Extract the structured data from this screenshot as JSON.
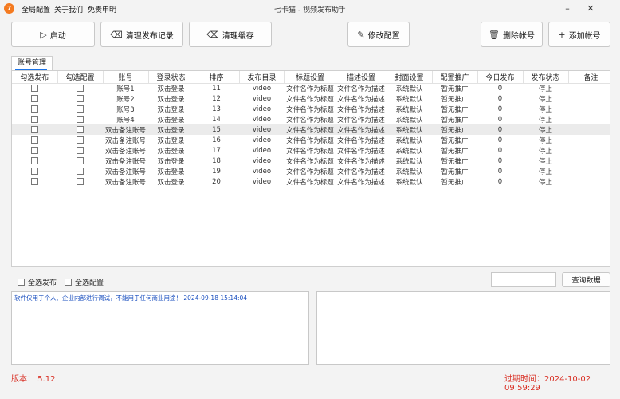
{
  "window": {
    "title": "七卡猫 - 视频发布助手",
    "app_icon": "7",
    "minimize": "–",
    "close": "✕"
  },
  "menu": [
    "全局配置",
    "关于我们",
    "免责申明"
  ],
  "toolbar": {
    "start": "启动",
    "clear_log": "清理发布记录",
    "clear_cache": "清理缓存",
    "modify_config": "修改配置",
    "delete_account": "删除帐号",
    "add_account": "添加帐号"
  },
  "tab": {
    "label": "账号管理"
  },
  "table": {
    "columns": [
      "勾选发布",
      "勾选配置",
      "账号",
      "登录状态",
      "排序",
      "发布目录",
      "标题设置",
      "描述设置",
      "封面设置",
      "配置推广",
      "今日发布",
      "发布状态",
      "备注"
    ],
    "rows": [
      [
        "账号1",
        "双击登录",
        "11",
        "video",
        "文件名作为标题",
        "文件名作为描述",
        "系统默认",
        "暂无推广",
        "0",
        "停止",
        ""
      ],
      [
        "账号2",
        "双击登录",
        "12",
        "video",
        "文件名作为标题",
        "文件名作为描述",
        "系统默认",
        "暂无推广",
        "0",
        "停止",
        ""
      ],
      [
        "账号3",
        "双击登录",
        "13",
        "video",
        "文件名作为标题",
        "文件名作为描述",
        "系统默认",
        "暂无推广",
        "0",
        "停止",
        ""
      ],
      [
        "账号4",
        "双击登录",
        "14",
        "video",
        "文件名作为标题",
        "文件名作为描述",
        "系统默认",
        "暂无推广",
        "0",
        "停止",
        ""
      ],
      [
        "双击备注账号",
        "双击登录",
        "15",
        "video",
        "文件名作为标题",
        "文件名作为描述",
        "系统默认",
        "暂无推广",
        "0",
        "停止",
        ""
      ],
      [
        "双击备注账号",
        "双击登录",
        "16",
        "video",
        "文件名作为标题",
        "文件名作为描述",
        "系统默认",
        "暂无推广",
        "0",
        "停止",
        ""
      ],
      [
        "双击备注账号",
        "双击登录",
        "17",
        "video",
        "文件名作为标题",
        "文件名作为描述",
        "系统默认",
        "暂无推广",
        "0",
        "停止",
        ""
      ],
      [
        "双击备注账号",
        "双击登录",
        "18",
        "video",
        "文件名作为标题",
        "文件名作为描述",
        "系统默认",
        "暂无推广",
        "0",
        "停止",
        ""
      ],
      [
        "双击备注账号",
        "双击登录",
        "19",
        "video",
        "文件名作为标题",
        "文件名作为描述",
        "系统默认",
        "暂无推广",
        "0",
        "停止",
        ""
      ],
      [
        "双击备注账号",
        "双击登录",
        "20",
        "video",
        "文件名作为标题",
        "文件名作为描述",
        "系统默认",
        "暂无推广",
        "0",
        "停止",
        ""
      ]
    ]
  },
  "bottom": {
    "select_all_publish": "全选发布",
    "select_all_config": "全选配置",
    "query_value": "",
    "query_button": "查询数据"
  },
  "log": {
    "message": "软件仅用于个人、企业内部进行调试，不能用于任何商业用途！ 2024-09-18 15:14:04"
  },
  "footer": {
    "version": "版本： 5.12",
    "expire": "过期时间：2024-10-02 09:59:29"
  }
}
